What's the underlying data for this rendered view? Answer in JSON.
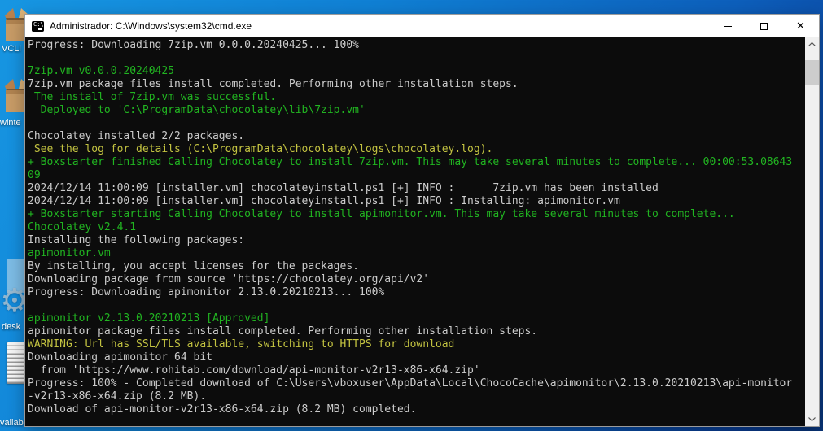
{
  "window": {
    "title": "Administrador: C:\\Windows\\system32\\cmd.exe",
    "icon_text": "C:\\",
    "controls": {
      "minimize": "minimize",
      "maximize": "maximize",
      "close": "✕"
    }
  },
  "desktop": {
    "icons": [
      {
        "kind": "package-box",
        "label": "VCLi"
      },
      {
        "kind": "package-box",
        "label": "winte"
      },
      {
        "kind": "settings-file",
        "label": "desk",
        "glyph": "⚙"
      },
      {
        "kind": "striped-list-file",
        "label": "vailabl"
      }
    ]
  },
  "console": {
    "colors": {
      "background": "#0C0C0C",
      "white": "#CCCCCC",
      "green": "#21B421",
      "yellow": "#C3C341"
    },
    "lines": [
      {
        "text": "Progress: Downloading 7zip.vm 0.0.0.20240425... 100%",
        "color": "white"
      },
      {
        "text": "",
        "color": "white"
      },
      {
        "text": "7zip.vm v0.0.0.20240425",
        "color": "green"
      },
      {
        "text": "7zip.vm package files install completed. Performing other installation steps.",
        "color": "white"
      },
      {
        "text": " The install of 7zip.vm was successful.",
        "color": "green"
      },
      {
        "text": "  Deployed to 'C:\\ProgramData\\chocolatey\\lib\\7zip.vm'",
        "color": "green"
      },
      {
        "text": "",
        "color": "white"
      },
      {
        "text": "Chocolatey installed 2/2 packages.",
        "color": "white"
      },
      {
        "text": " See the log for details (C:\\ProgramData\\chocolatey\\logs\\chocolatey.log).",
        "color": "yellow"
      },
      {
        "text": "+ Boxstarter finished Calling Chocolatey to install 7zip.vm. This may take several minutes to complete... 00:00:53.08643",
        "color": "green"
      },
      {
        "text": "09",
        "color": "green"
      },
      {
        "text": "2024/12/14 11:00:09 [installer.vm] chocolateyinstall.ps1 [+] INFO :      7zip.vm has been installed",
        "color": "white"
      },
      {
        "text": "2024/12/14 11:00:09 [installer.vm] chocolateyinstall.ps1 [+] INFO : Installing: apimonitor.vm",
        "color": "white"
      },
      {
        "text": "+ Boxstarter starting Calling Chocolatey to install apimonitor.vm. This may take several minutes to complete...",
        "color": "green"
      },
      {
        "text": "Chocolatey v2.4.1",
        "color": "green"
      },
      {
        "text": "Installing the following packages:",
        "color": "white"
      },
      {
        "text": "apimonitor.vm",
        "color": "green"
      },
      {
        "text": "By installing, you accept licenses for the packages.",
        "color": "white"
      },
      {
        "text": "Downloading package from source 'https://chocolatey.org/api/v2'",
        "color": "white"
      },
      {
        "text": "Progress: Downloading apimonitor 2.13.0.20210213... 100%",
        "color": "white"
      },
      {
        "text": "",
        "color": "white"
      },
      {
        "text": "apimonitor v2.13.0.20210213 [Approved]",
        "color": "green"
      },
      {
        "text": "apimonitor package files install completed. Performing other installation steps.",
        "color": "white"
      },
      {
        "text": "WARNING: Url has SSL/TLS available, switching to HTTPS for download",
        "color": "yellow"
      },
      {
        "text": "Downloading apimonitor 64 bit",
        "color": "white"
      },
      {
        "text": "  from 'https://www.rohitab.com/download/api-monitor-v2r13-x86-x64.zip'",
        "color": "white"
      },
      {
        "text": "Progress: 100% - Completed download of C:\\Users\\vboxuser\\AppData\\Local\\ChocoCache\\apimonitor\\2.13.0.20210213\\api-monitor",
        "color": "white"
      },
      {
        "text": "-v2r13-x86-x64.zip (8.2 MB).",
        "color": "white"
      },
      {
        "text": "Download of api-monitor-v2r13-x86-x64.zip (8.2 MB) completed.",
        "color": "white"
      }
    ]
  }
}
